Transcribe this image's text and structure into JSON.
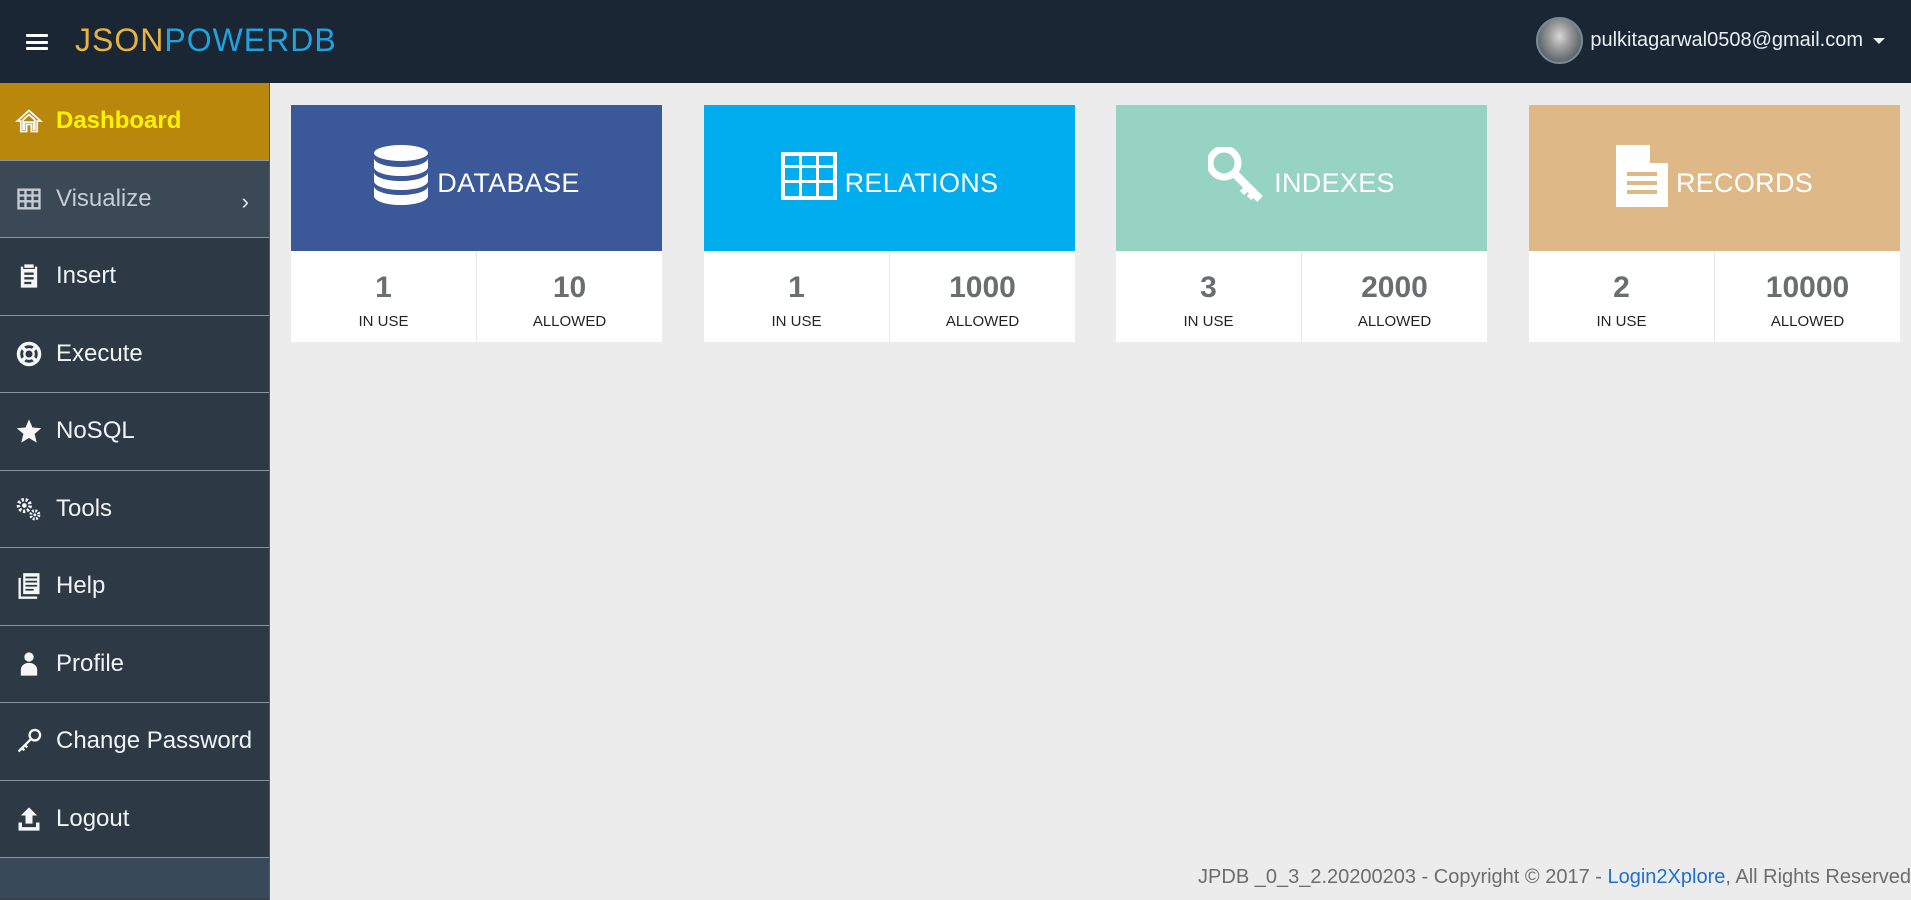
{
  "header": {
    "brand_part1": "JSON",
    "brand_part2": "POWERDB",
    "user_email": "pulkitagarwal0508@gmail.com"
  },
  "sidebar": {
    "items": [
      {
        "label": "Dashboard",
        "icon": "home-icon",
        "active": true
      },
      {
        "label": "Visualize",
        "icon": "table-grid-icon",
        "has_submenu": true
      },
      {
        "label": "Insert",
        "icon": "clipboard-icon"
      },
      {
        "label": "Execute",
        "icon": "life-ring-icon"
      },
      {
        "label": "NoSQL",
        "icon": "star-icon"
      },
      {
        "label": "Tools",
        "icon": "gears-icon"
      },
      {
        "label": "Help",
        "icon": "document-list-icon"
      },
      {
        "label": "Profile",
        "icon": "user-icon"
      },
      {
        "label": "Change Password",
        "icon": "key-icon"
      },
      {
        "label": "Logout",
        "icon": "upload-icon"
      }
    ]
  },
  "cards": [
    {
      "title": "DATABASE",
      "color": "#3b5998",
      "icon": "database-icon",
      "in_use": "1",
      "in_use_label": "IN USE",
      "allowed": "10",
      "allowed_label": "ALLOWED"
    },
    {
      "title": "RELATIONS",
      "color": "#00aeef",
      "icon": "table-icon",
      "in_use": "1",
      "in_use_label": "IN USE",
      "allowed": "1000",
      "allowed_label": "ALLOWED"
    },
    {
      "title": "INDEXES",
      "color": "#96d3c3",
      "icon": "key-icon",
      "in_use": "3",
      "in_use_label": "IN USE",
      "allowed": "2000",
      "allowed_label": "ALLOWED"
    },
    {
      "title": "RECORDS",
      "color": "#deb887",
      "icon": "file-icon",
      "in_use": "2",
      "in_use_label": "IN USE",
      "allowed": "10000",
      "allowed_label": "ALLOWED"
    }
  ],
  "footer": {
    "prefix": "JPDB _0_3_2.20200203 - Copyright © 2017 - ",
    "link": "Login2Xplore",
    "suffix": ", All Rights Reserved"
  },
  "colors": {
    "topbar": "#1a2634",
    "sidebar": "#2d3944",
    "active_item": "#b8870b",
    "active_text": "#fff200",
    "brand_gold": "#e8b33f",
    "brand_blue": "#1ea3dc",
    "link": "#1e6fd1"
  }
}
